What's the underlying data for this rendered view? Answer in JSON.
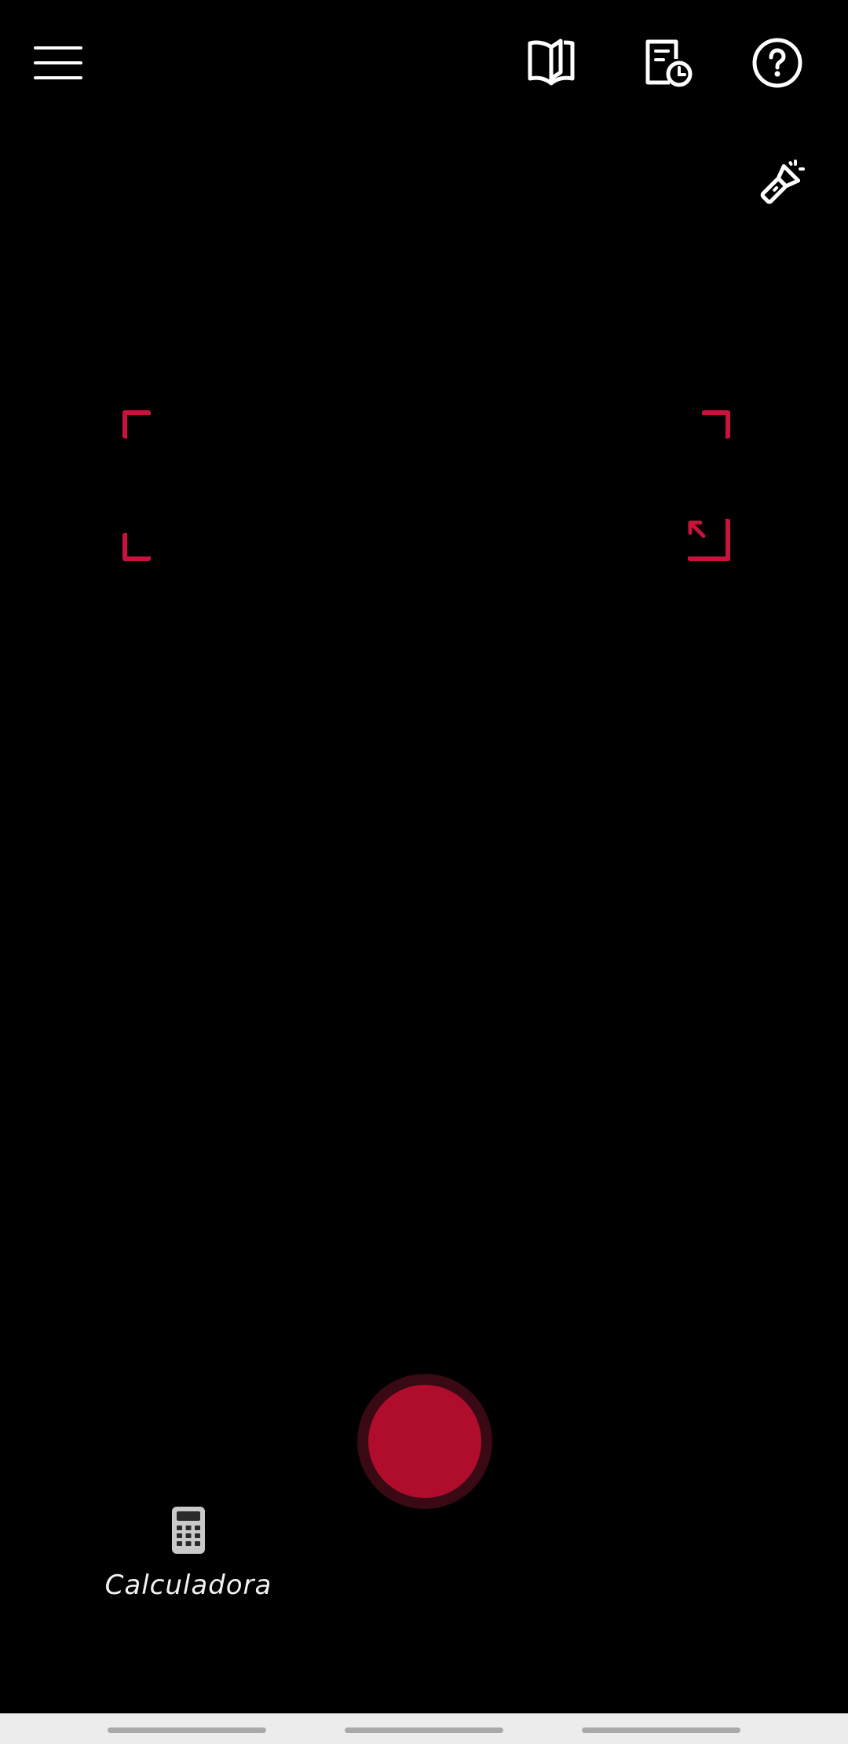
{
  "toolbar": {
    "menu_icon": "hamburger-menu-icon",
    "guide_icon": "open-book-icon",
    "history_icon": "document-clock-icon",
    "help_icon": "question-circle-icon",
    "flash_icon": "flashlight-icon"
  },
  "viewfinder": {
    "frame_color": "#c8143c",
    "resize_icon": "arrow-up-left-icon"
  },
  "capture": {
    "ring_color": "#3a0a14",
    "button_color": "#b00d2d"
  },
  "shortcut": {
    "icon": "calculator-icon",
    "label": "Calculadora"
  }
}
